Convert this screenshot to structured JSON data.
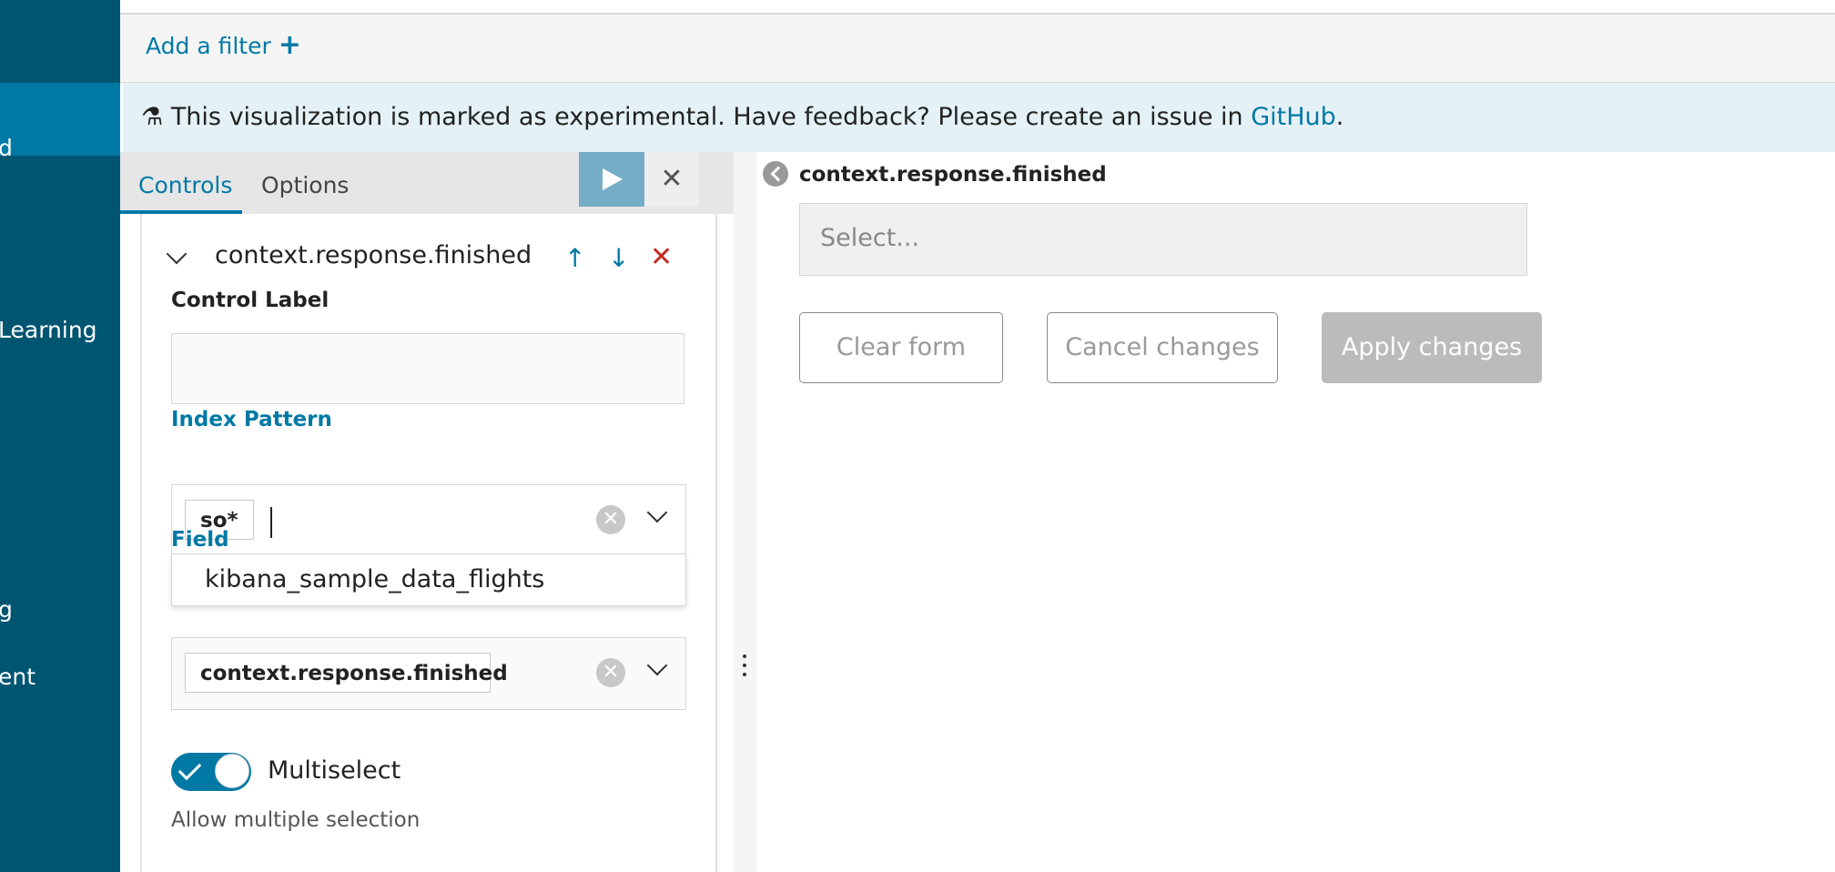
{
  "sidebar": {
    "items": [
      {
        "label": "d"
      },
      {
        "label": "Learning"
      },
      {
        "label": "g"
      },
      {
        "label": "ent"
      }
    ]
  },
  "filter_bar": {
    "add_filter_label": "Add a filter",
    "add_filter_icon": "+"
  },
  "banner": {
    "icon": "⚗",
    "message": "This visualization is marked as experimental. Have feedback? Please create an issue in ",
    "link_text": "GitHub",
    "suffix": "."
  },
  "editor": {
    "tabs": [
      {
        "label": "Controls"
      },
      {
        "label": "Options"
      }
    ],
    "run_icon": "play-icon",
    "close_icon": "✕",
    "control": {
      "title": "context.response.finished",
      "move_up_icon": "↑",
      "move_down_icon": "↓",
      "remove_icon": "✕",
      "control_label_title": "Control Label",
      "control_label_value": "",
      "index_pattern_title": "Index Pattern",
      "index_pattern_chip": "so*",
      "index_pattern_suggestion": "kibana_sample_data_flights",
      "field_title": "Field",
      "field_chip": "context.response.finished",
      "clear_icon": "✕",
      "multiselect_label": "Multiselect",
      "multiselect_help": "Allow multiple selection",
      "multiselect_on": true
    }
  },
  "preview": {
    "control_label": "context.response.finished",
    "select_placeholder": "Select...",
    "buttons": {
      "clear": "Clear form",
      "cancel": "Cancel changes",
      "apply": "Apply changes"
    }
  },
  "colors": {
    "sidebar": "#005571",
    "accent": "#0079a5",
    "banner_bg": "#e4f2f7",
    "danger": "#c4281c"
  }
}
